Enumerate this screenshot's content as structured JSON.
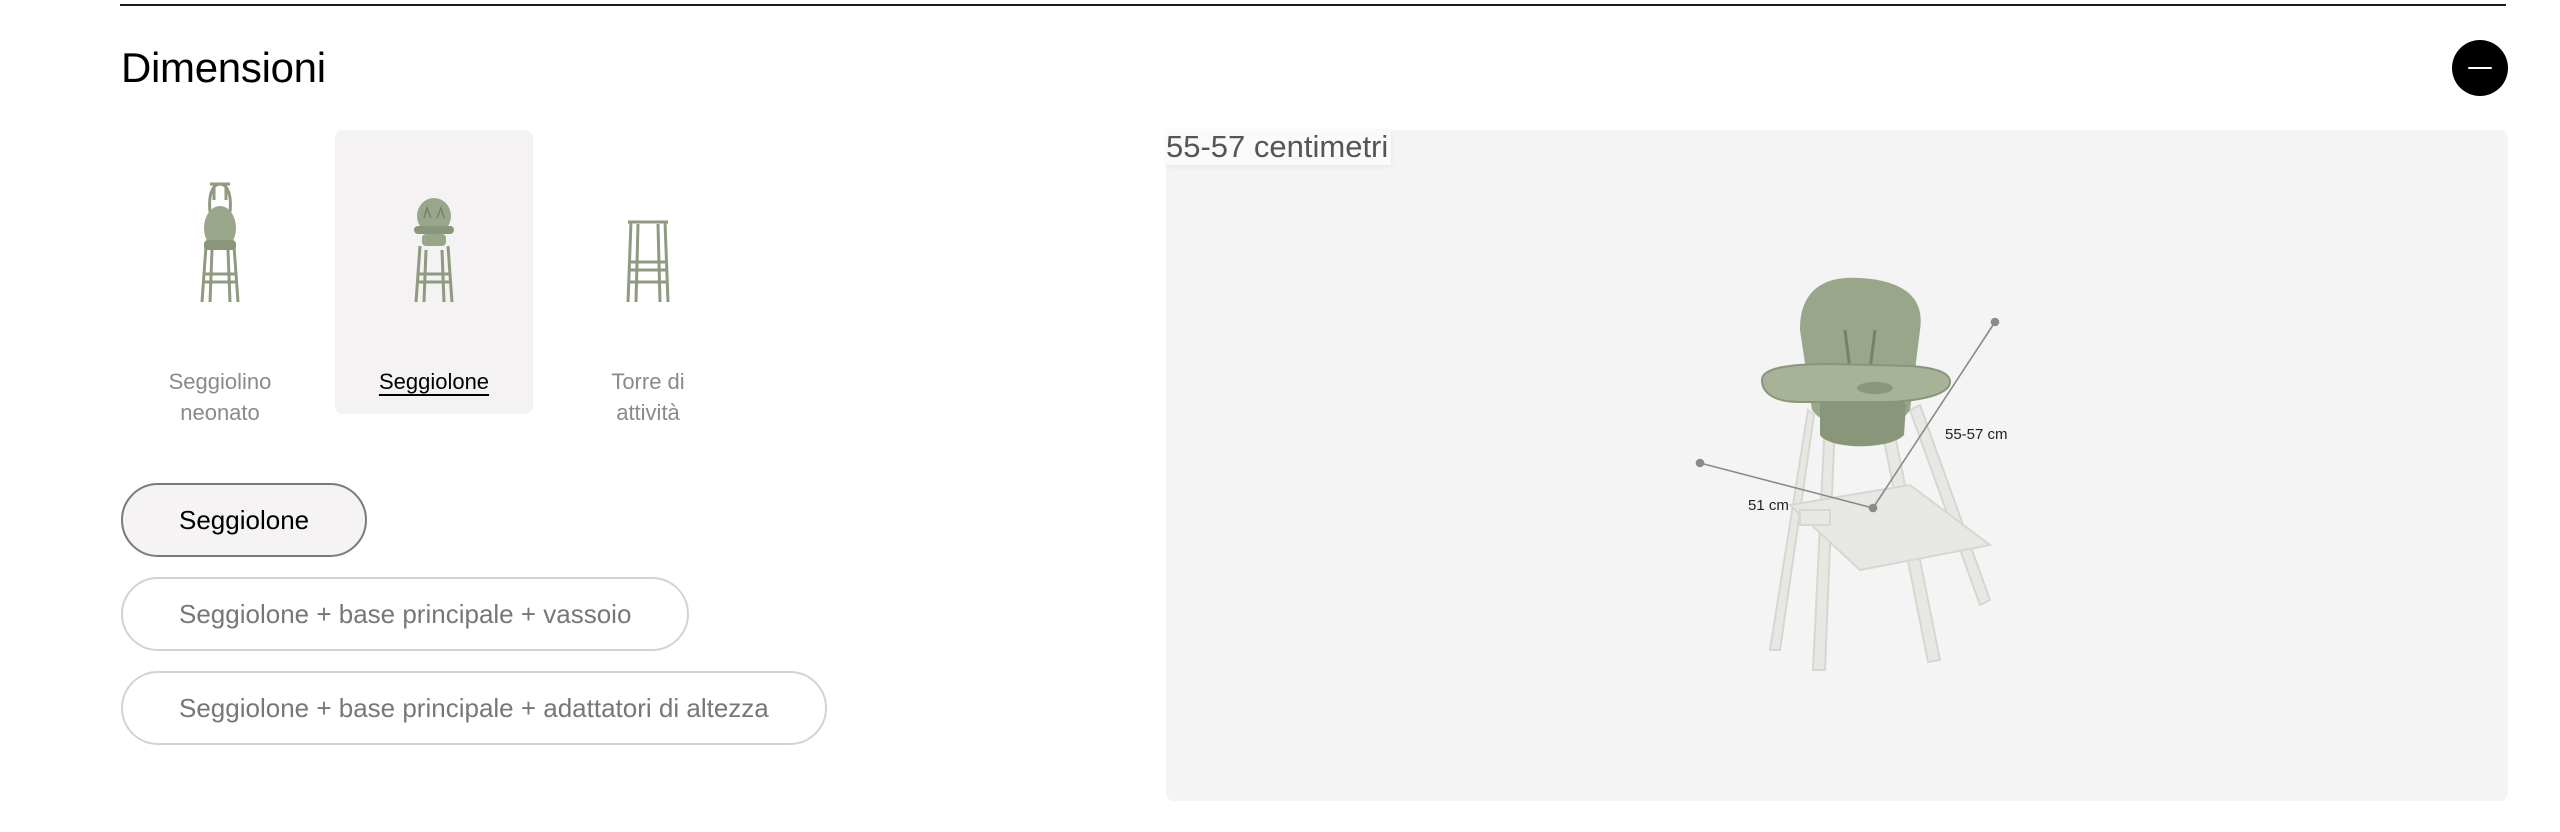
{
  "section": {
    "title": "Dimensioni"
  },
  "modes": [
    {
      "label_line1": "Seggiolino",
      "label_line2": "neonato",
      "active": false,
      "icon": "newborn-seat-chair-icon"
    },
    {
      "label": "Seggiolone",
      "active": true,
      "icon": "highchair-icon"
    },
    {
      "label_line1": "Torre di",
      "label_line2": "attività",
      "active": false,
      "icon": "activity-tower-icon"
    }
  ],
  "options": [
    {
      "label": "Seggiolone",
      "selected": true
    },
    {
      "label": "Seggiolone + base principale + vassoio",
      "selected": false
    },
    {
      "label": "Seggiolone + base principale + adattatori di altezza",
      "selected": false
    }
  ],
  "image": {
    "dimension_caption": "55-57 centimetri",
    "height_label": "55-57 cm",
    "width_label": "51 cm",
    "colors": {
      "chair_green": "#9aa68a",
      "frame_white": "#e7e8e3"
    }
  },
  "collapse_icon": "minus-icon"
}
